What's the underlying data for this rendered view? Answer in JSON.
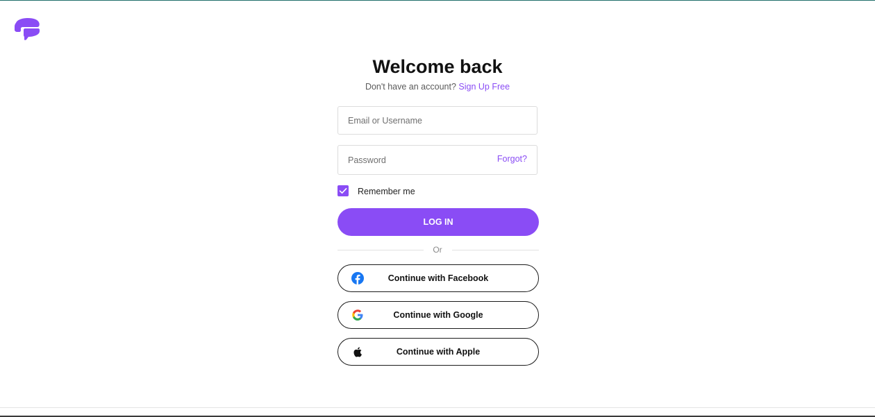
{
  "brand": {
    "logo_icon": "chat-bubble-logo-icon",
    "accent_color": "#8a4cf5"
  },
  "header": {
    "title": "Welcome back",
    "no_account_text": "Don't have an account?",
    "signup_link": "Sign Up Free"
  },
  "form": {
    "email_placeholder": "Email or Username",
    "password_placeholder": "Password",
    "forgot_link": "Forgot?",
    "remember_me_label": "Remember me",
    "remember_me_checked": true,
    "login_button": "LOG IN",
    "divider_text": "Or"
  },
  "social": {
    "facebook": {
      "label": "Continue with Facebook",
      "icon": "facebook-icon"
    },
    "google": {
      "label": "Continue with Google",
      "icon": "google-icon"
    },
    "apple": {
      "label": "Continue with Apple",
      "icon": "apple-icon"
    }
  }
}
